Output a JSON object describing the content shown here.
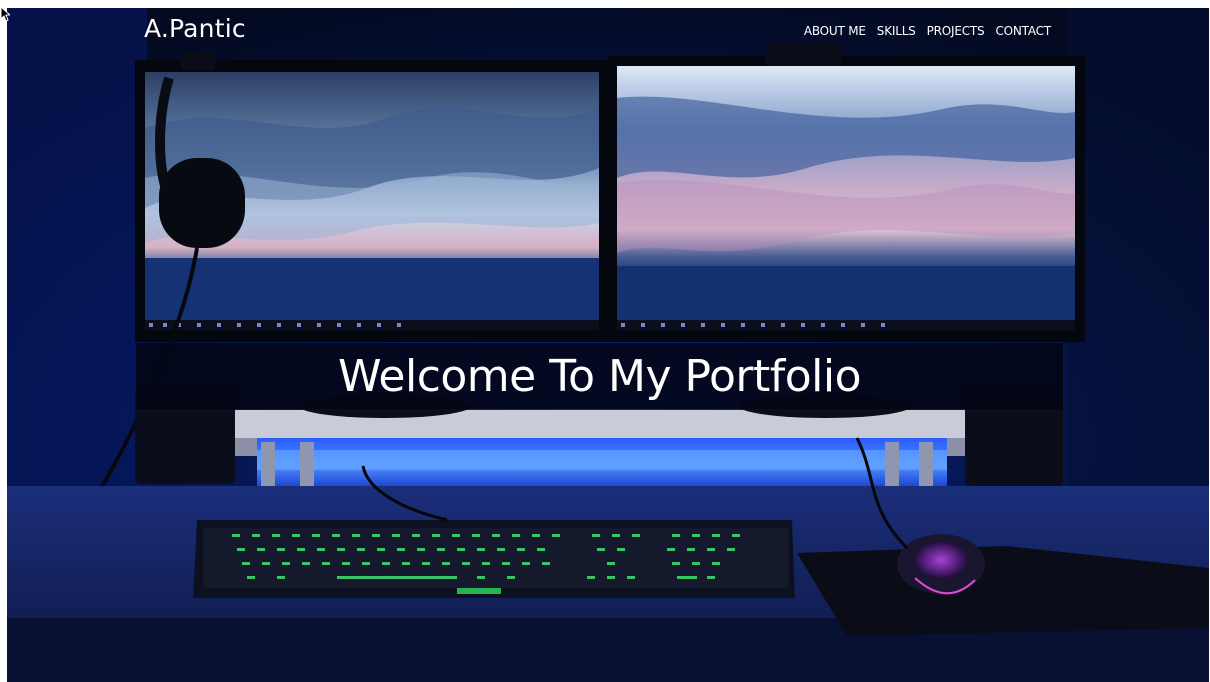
{
  "site": {
    "brand": "A.Pantic"
  },
  "nav": {
    "items": [
      {
        "label": "ABOUT ME"
      },
      {
        "label": "SKILLS"
      },
      {
        "label": "PROJECTS"
      },
      {
        "label": "CONTACT"
      }
    ]
  },
  "hero": {
    "title": "Welcome To My Portfolio",
    "background_description_icon": "desk-setup-photo"
  },
  "colors": {
    "background_dark": "#050c22",
    "text": "#ffffff",
    "band": "#03061a",
    "accent_blue": "#1a3cff",
    "keyboard_green": "#3cff6a"
  }
}
